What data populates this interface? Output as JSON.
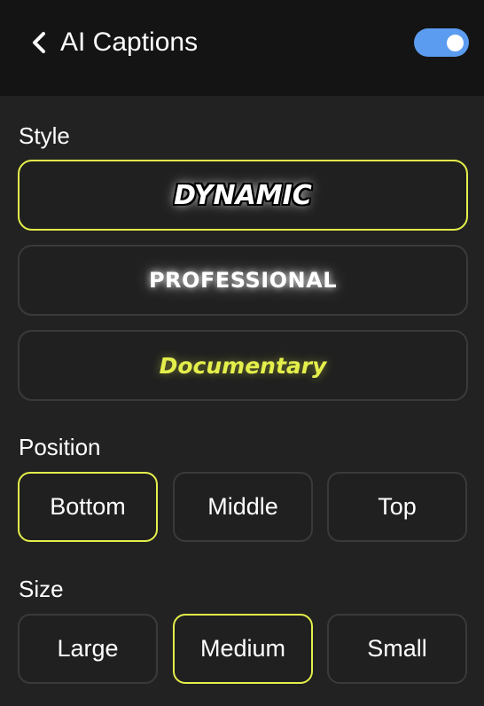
{
  "header": {
    "title": "AI Captions",
    "back_icon": "chevron-left-icon",
    "toggle_on": true,
    "toggle_color": "#5b9cf0"
  },
  "style_section": {
    "label": "Style",
    "options": [
      {
        "label": "DYNAMIC",
        "selected": true
      },
      {
        "label": "PROFESSIONAL",
        "selected": false
      },
      {
        "label": "Documentary",
        "selected": false
      }
    ]
  },
  "position_section": {
    "label": "Position",
    "options": [
      {
        "label": "Bottom",
        "selected": true
      },
      {
        "label": "Middle",
        "selected": false
      },
      {
        "label": "Top",
        "selected": false
      }
    ]
  },
  "size_section": {
    "label": "Size",
    "options": [
      {
        "label": "Large",
        "selected": false
      },
      {
        "label": "Medium",
        "selected": true
      },
      {
        "label": "Small",
        "selected": false
      }
    ]
  },
  "colors": {
    "accent": "#e4ef4b",
    "background": "#222222",
    "header_background": "#141414",
    "border": "#3a3a3a"
  }
}
